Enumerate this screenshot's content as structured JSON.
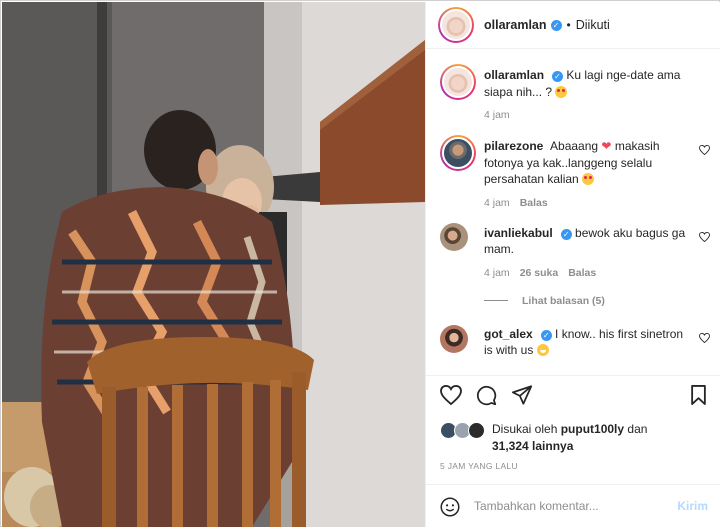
{
  "post": {
    "username": "ollaramlan",
    "follow_status": "Diikuti",
    "dot": "•"
  },
  "comments": [
    {
      "username": "ollaramlan",
      "text": "Ku lagi nge-date ama siapa nih... ?",
      "time": "4 jam",
      "verified": true
    },
    {
      "username": "pilarezone",
      "text_a": "Abaaang",
      "text_b": "makasih fotonya ya kak..langgeng selalu persahatan kalian",
      "time": "4 jam",
      "reply": "Balas"
    },
    {
      "username": "ivanliekabul",
      "text": "bewok aku bagus ga mam.",
      "time": "4 jam",
      "likes": "26 suka",
      "reply": "Balas",
      "verified": true
    },
    {
      "view_replies": "Lihat balasan (5)"
    },
    {
      "username": "got_alex",
      "text": "I know.. his first sinetron is with us",
      "verified": true
    }
  ],
  "likes": {
    "prefix": "Disukai oleh",
    "user": "puput100ly",
    "and": "dan",
    "count": "31,324",
    "suffix": "lainnya"
  },
  "timestamp": "5 JAM YANG LALU",
  "add_comment": {
    "placeholder": "Tambahkan komentar...",
    "post_label": "Kirim"
  },
  "icons": [
    "heart-icon",
    "comment-icon",
    "share-icon",
    "bookmark-icon",
    "emoji-icon",
    "verified-icon"
  ],
  "colors": {
    "verified": "#3897f0",
    "muted": "#8e8e8e",
    "post_disabled": "#b3dbff"
  }
}
